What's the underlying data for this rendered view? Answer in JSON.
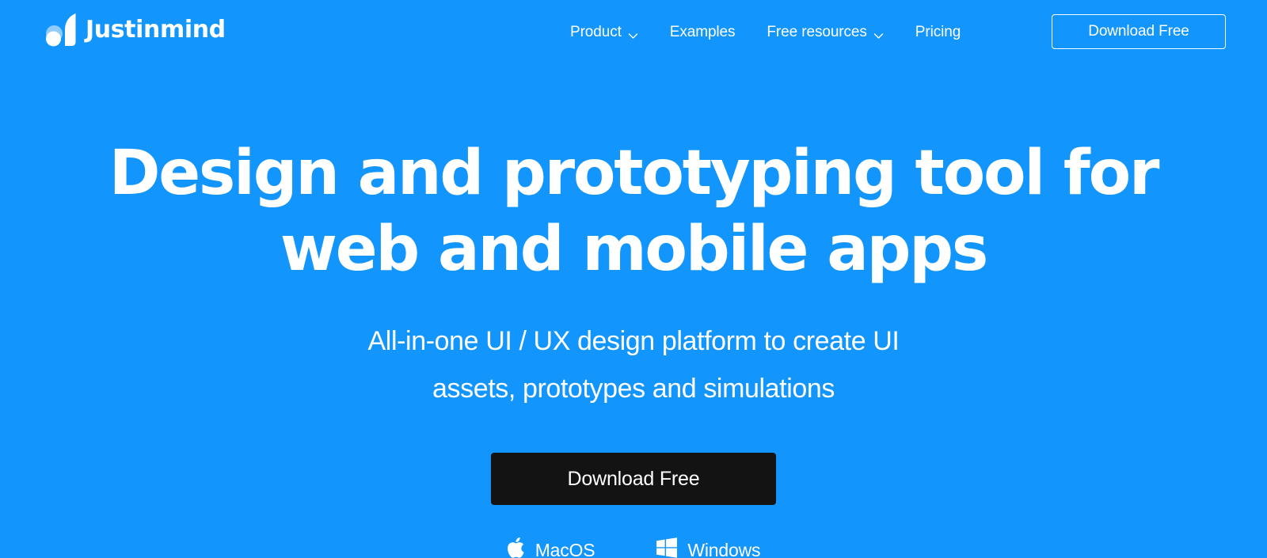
{
  "theme": {
    "background": "#1295fc",
    "text_on_blue": "#ffffff",
    "cta_dark": "#131313",
    "logo_light_circle": "#8fcbfd"
  },
  "header": {
    "brand": {
      "name": "Justinmind",
      "logo_icon": "justinmind-logo-icon"
    },
    "nav": [
      {
        "label": "Product",
        "has_dropdown": true,
        "icon": "chevron-down-icon"
      },
      {
        "label": "Examples",
        "has_dropdown": false,
        "icon": ""
      },
      {
        "label": "Free resources",
        "has_dropdown": true,
        "icon": "chevron-down-icon"
      },
      {
        "label": "Pricing",
        "has_dropdown": false,
        "icon": ""
      }
    ],
    "cta_label": "Download Free"
  },
  "hero": {
    "title_line_1": "Design and prototyping tool for",
    "title_line_2": "web and mobile apps",
    "subtitle_line_1": "All-in-one UI / UX design platform to create UI",
    "subtitle_line_2": "assets, prototypes and simulations",
    "cta_label": "Download Free",
    "os_options": [
      {
        "label": "MacOS",
        "icon": "apple-icon"
      },
      {
        "label": "Windows",
        "icon": "windows-icon"
      }
    ]
  }
}
